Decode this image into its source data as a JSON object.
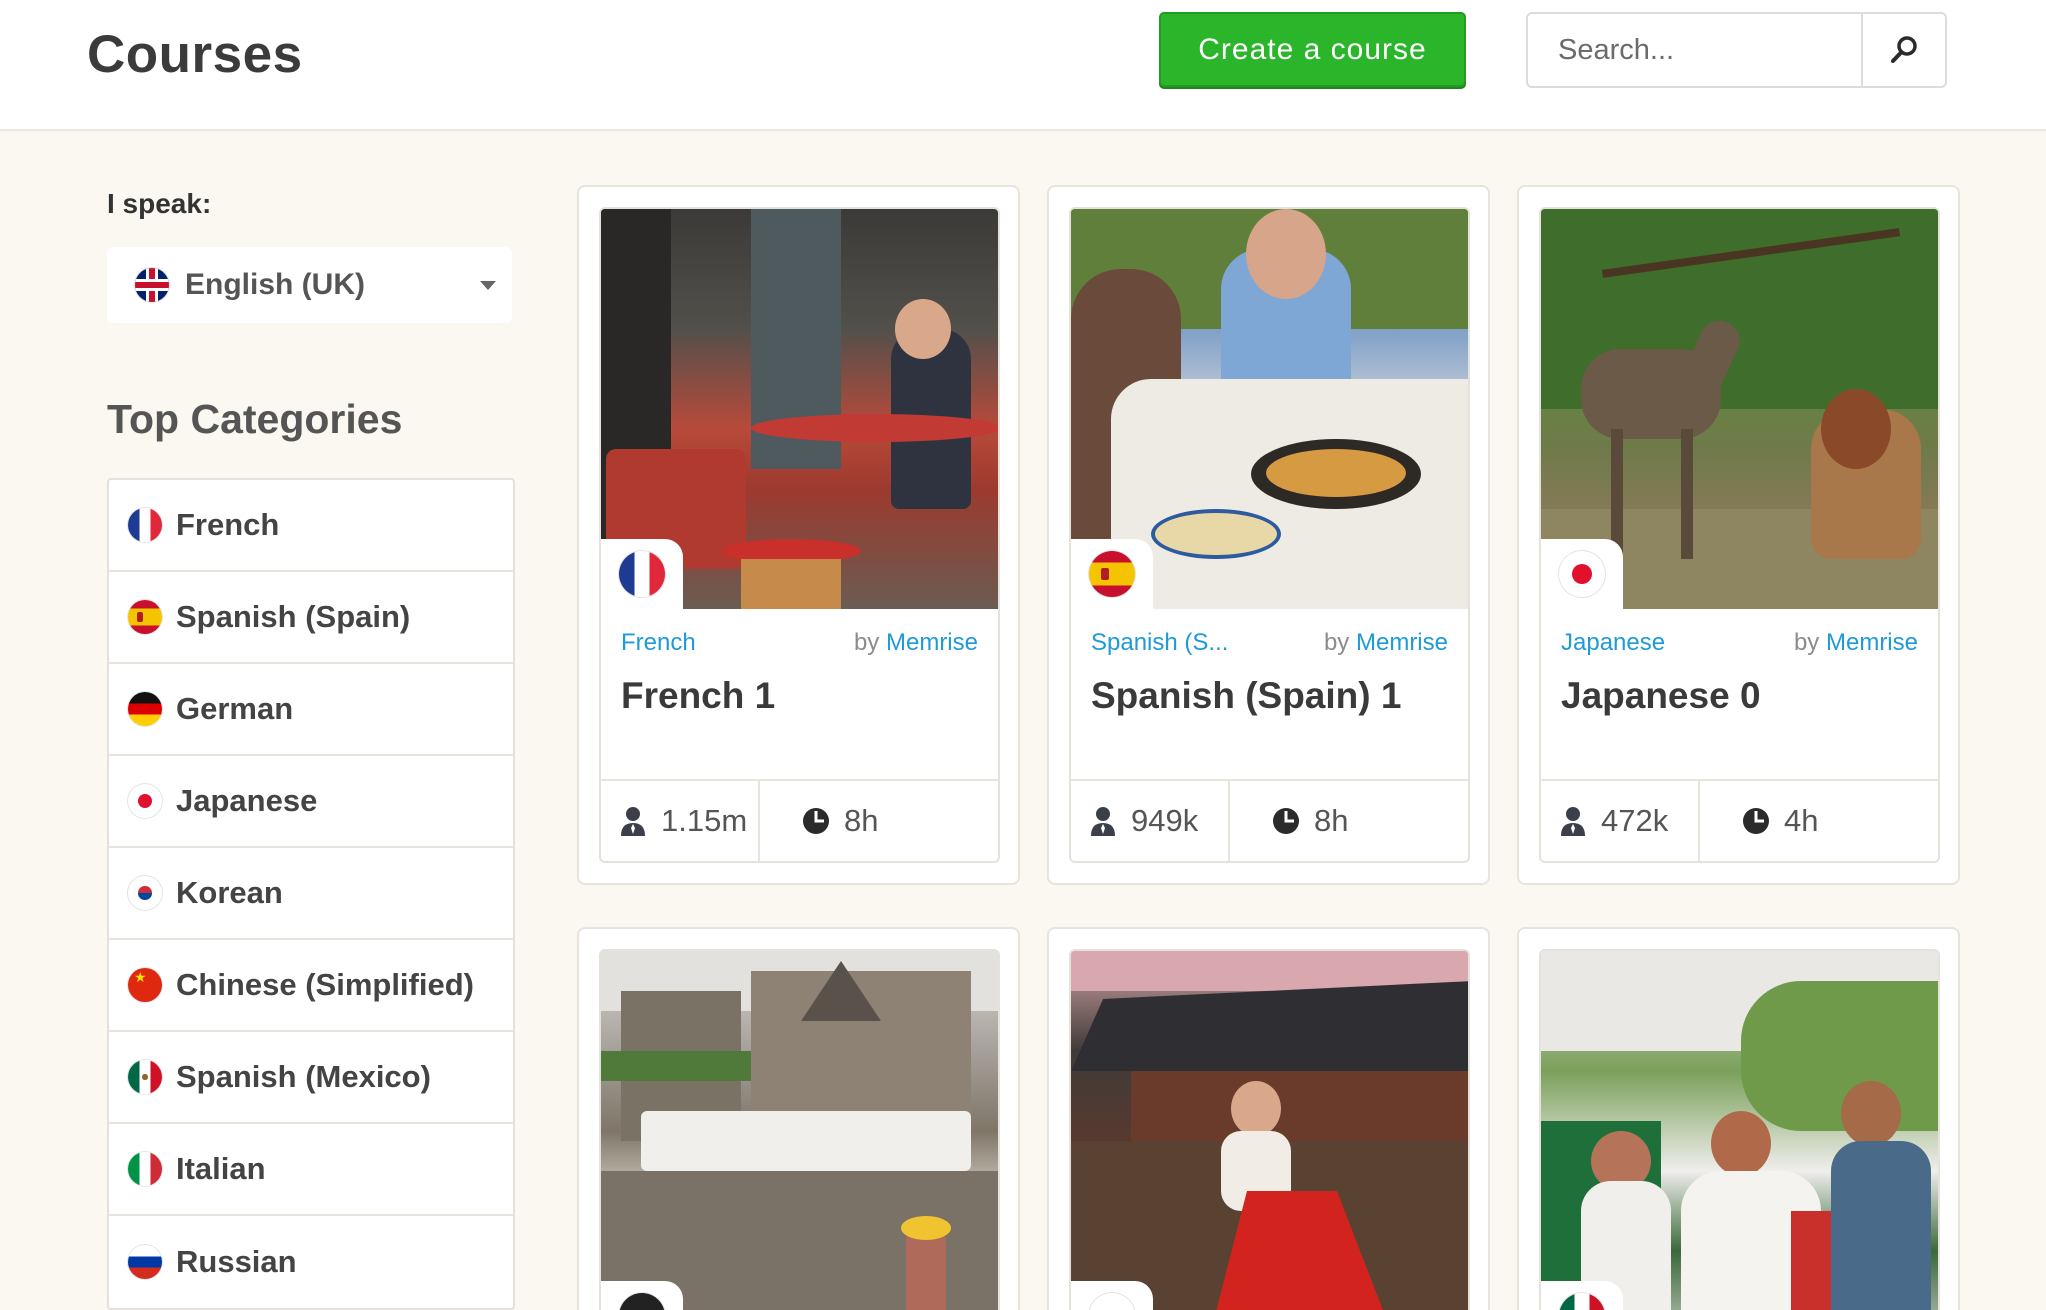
{
  "header": {
    "title": "Courses",
    "create_label": "Create a course",
    "search_placeholder": "Search..."
  },
  "sidebar": {
    "speak_label": "I speak:",
    "selected_language": "English (UK)",
    "categories_title": "Top Categories",
    "categories": [
      {
        "label": "French",
        "flag": "france-flag-icon"
      },
      {
        "label": "Spanish (Spain)",
        "flag": "spain-flag-icon"
      },
      {
        "label": "German",
        "flag": "germany-flag-icon"
      },
      {
        "label": "Japanese",
        "flag": "japan-flag-icon"
      },
      {
        "label": "Korean",
        "flag": "korea-flag-icon"
      },
      {
        "label": "Chinese (Simplified)",
        "flag": "china-flag-icon"
      },
      {
        "label": "Spanish (Mexico)",
        "flag": "mexico-flag-icon"
      },
      {
        "label": "Italian",
        "flag": "italy-flag-icon"
      },
      {
        "label": "Russian",
        "flag": "russia-flag-icon"
      }
    ]
  },
  "courses": [
    {
      "category": "French",
      "by": "by",
      "author": "Memrise",
      "title": "French 1",
      "learners": "1.15m",
      "time": "8h",
      "flag": "france-flag-icon"
    },
    {
      "category": "Spanish (S...",
      "by": "by",
      "author": "Memrise",
      "title": "Spanish (Spain) 1",
      "learners": "949k",
      "time": "8h",
      "flag": "spain-flag-icon"
    },
    {
      "category": "Japanese",
      "by": "by",
      "author": "Memrise",
      "title": "Japanese 0",
      "learners": "472k",
      "time": "4h",
      "flag": "japan-flag-icon"
    }
  ],
  "colors": {
    "accent_green": "#2bb52b",
    "link_blue": "#1e9bd7",
    "page_bg": "#faf8f1"
  }
}
